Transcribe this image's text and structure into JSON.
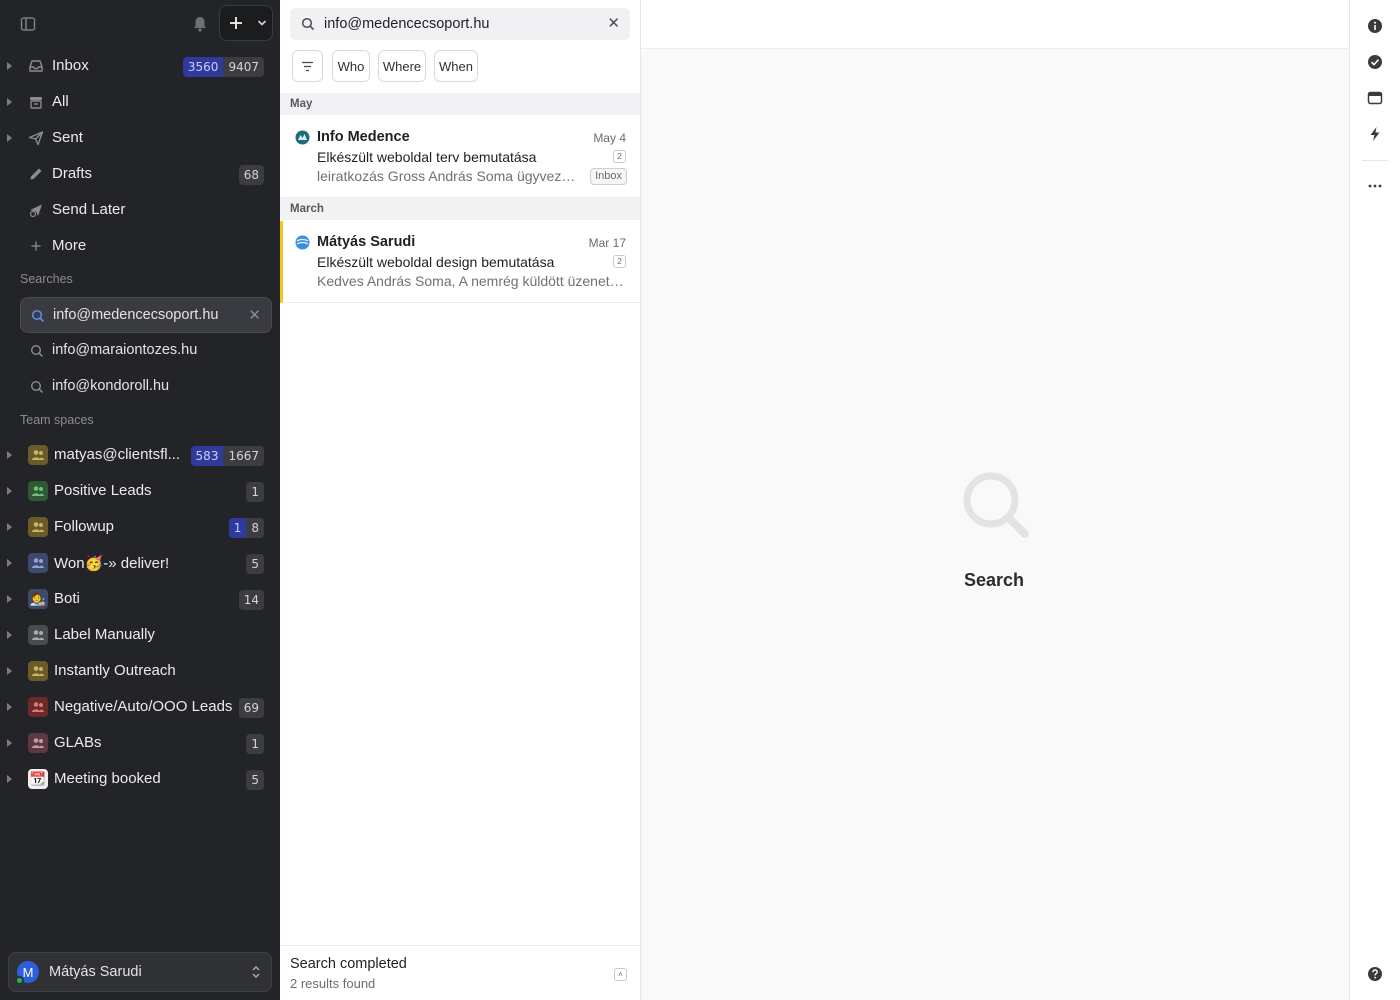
{
  "sidebar": {
    "mailboxes": [
      {
        "label": "Inbox",
        "unread": "3560",
        "total": "9407"
      },
      {
        "label": "All"
      },
      {
        "label": "Sent"
      },
      {
        "label": "Drafts",
        "total": "68"
      },
      {
        "label": "Send Later"
      },
      {
        "label": "More"
      }
    ],
    "searches_title": "Searches",
    "searches": [
      {
        "label": "info@medencecsoport.hu"
      },
      {
        "label": "info@maraiontozes.hu"
      },
      {
        "label": "info@kondoroll.hu"
      }
    ],
    "team_title": "Team spaces",
    "teams": [
      {
        "label": "matyas@clientsfl...",
        "unread": "583",
        "total": "1667",
        "emoji": ""
      },
      {
        "label": "Positive Leads",
        "total": "1",
        "emoji": ""
      },
      {
        "label": "Followup",
        "unread": "1",
        "total": "8",
        "emoji": ""
      },
      {
        "label": "Won🥳-» deliver!",
        "total": "5",
        "emoji": ""
      },
      {
        "label": "Boti",
        "total": "14",
        "emoji": "🧑‍🎨"
      },
      {
        "label": "Label Manually",
        "emoji": ""
      },
      {
        "label": "Instantly Outreach",
        "emoji": ""
      },
      {
        "label": "Negative/Auto/OOO Leads",
        "total": "69",
        "emoji": ""
      },
      {
        "label": "GLABs",
        "total": "1",
        "emoji": ""
      },
      {
        "label": "Meeting booked",
        "total": "5",
        "emoji": "📆"
      }
    ],
    "account": {
      "initial": "M",
      "name": "Mátyás Sarudi"
    }
  },
  "list": {
    "query": "info@medencecsoport.hu",
    "filters": [
      "Who",
      "Where",
      "When"
    ],
    "groups": [
      {
        "title": "May",
        "messages": [
          {
            "from": "Info Medence",
            "date": "May 4",
            "subject": "Elkészült weboldal terv bemutatása",
            "thread": "2",
            "preview": "leiratkozás Gross András Soma ügyvezető",
            "label": "Inbox"
          }
        ]
      },
      {
        "title": "March",
        "messages": [
          {
            "from": "Mátyás Sarudi",
            "date": "Mar 17",
            "subject": "Elkészült weboldal design bemutatása",
            "thread": "2",
            "preview": "Kedves András Soma, A nemrég küldött üzenetemre"
          }
        ]
      }
    ],
    "status": {
      "title": "Search completed",
      "detail": "2 results found"
    }
  },
  "reading": {
    "empty_text": "Search"
  },
  "colors": {
    "sidebar_bg": "#232427",
    "unread_badge": "#2f3b9c",
    "flag_accent": "#f5c518"
  }
}
